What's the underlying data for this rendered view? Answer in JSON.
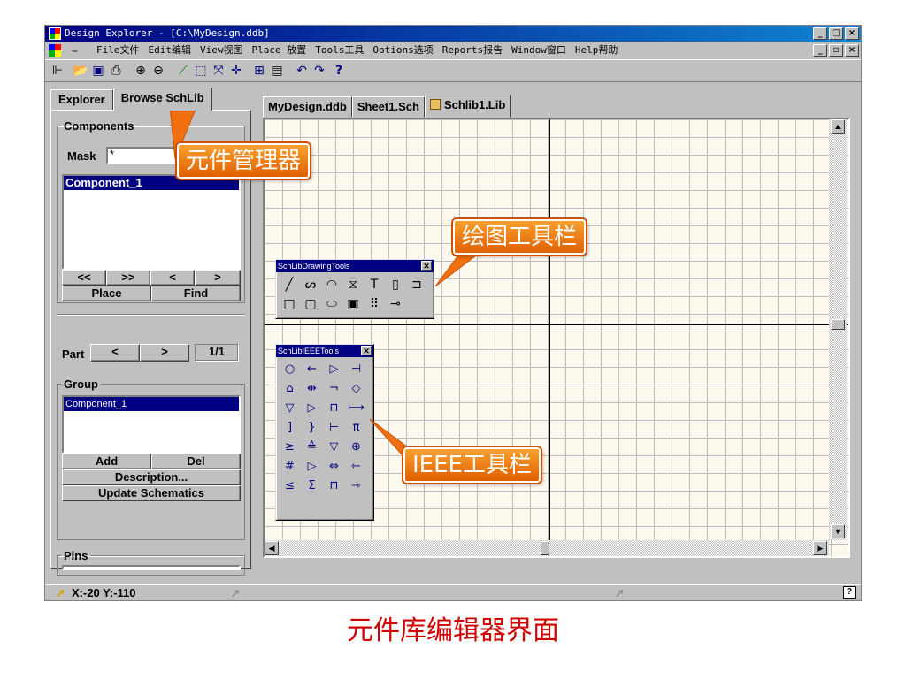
{
  "window": {
    "title": "Design Explorer - [C:\\MyDesign.ddb]"
  },
  "caption_buttons": {
    "minimize": "_",
    "maximize": "□",
    "close": "×",
    "restore": "▫"
  },
  "menu": [
    {
      "label": "File文件",
      "key": "F"
    },
    {
      "label": "Edit编辑",
      "key": "E"
    },
    {
      "label": "View视图",
      "key": "V"
    },
    {
      "label": "Place 放置",
      "key": "P"
    },
    {
      "label": "Tools工具",
      "key": "T"
    },
    {
      "label": "Options选项",
      "key": "O"
    },
    {
      "label": "Reports报告",
      "key": "R"
    },
    {
      "label": "Window窗口",
      "key": "W"
    },
    {
      "label": "Help帮助",
      "key": "H"
    }
  ],
  "left_panel": {
    "tabs": [
      "Explorer",
      "Browse SchLib"
    ],
    "active_tab": 1,
    "components_legend": "Components",
    "mask_label": "Mask",
    "mask_value": "*",
    "component_list": [
      "Component_1"
    ],
    "nav_buttons": [
      "<<",
      ">>",
      "<",
      ">"
    ],
    "place_label": "Place",
    "find_label": "Find",
    "part_label": "Part",
    "part_prev": "<",
    "part_next": ">",
    "part_value": "1/1",
    "group_legend": "Group",
    "group_list": [
      "Component_1"
    ],
    "add_label": "Add",
    "del_label": "Del",
    "description_label": "Description...",
    "update_label": "Update Schematics",
    "pins_legend": "Pins"
  },
  "doc_tabs": [
    "MyDesign.ddb",
    "Sheet1.Sch",
    "Schlib1.Lib"
  ],
  "active_doc_tab": 2,
  "drawing_tools": {
    "title": "SchLibDrawingTools",
    "icons": [
      "line-icon",
      "bezier-icon",
      "arc-icon",
      "polygon-icon",
      "text-icon",
      "component-icon",
      "part-icon",
      "rectangle-icon",
      "round-rectangle-icon",
      "ellipse-icon",
      "graphic-icon",
      "array-icon",
      "pin-icon"
    ],
    "glyphs": [
      "╱",
      "ᔕ",
      "◠",
      "⧖",
      "T",
      "▯",
      "⊐",
      "□",
      "▢",
      "⬭",
      "▣",
      "⠿",
      "⊸"
    ]
  },
  "ieee_tools": {
    "title": "SchLibIEEETools",
    "glyphs": [
      "○",
      "←",
      "▷",
      "⊣",
      "⌂",
      "⇹",
      "¬",
      "◇",
      "▽",
      "▷",
      "⊓",
      "⟼",
      "]",
      "}",
      "⊢",
      "π",
      "≥",
      "≙",
      "▽",
      "⊕",
      "#",
      "▷",
      "⇔",
      "⇽",
      "≤",
      "Σ",
      "⊓",
      "⇾"
    ]
  },
  "status": {
    "coords": "X:-20 Y:-110",
    "help_icon": "?"
  },
  "callouts": {
    "component_manager": "元件管理器",
    "drawing_toolbar": "绘图工具栏",
    "ieee_toolbar": "IEEE工具栏"
  },
  "caption": "元件库编辑器界面"
}
